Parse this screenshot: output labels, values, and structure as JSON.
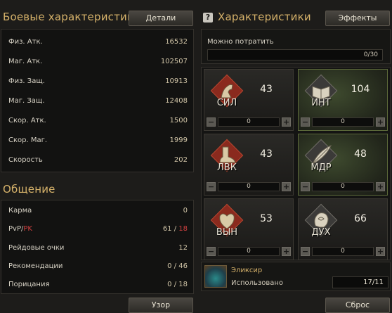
{
  "combat": {
    "title": "Боевые характеристики",
    "details_label": "Детали",
    "rows": [
      {
        "label": "Физ. Атк.",
        "value": "16532"
      },
      {
        "label": "Маг. Атк.",
        "value": "102507"
      },
      {
        "label": "Физ. Защ.",
        "value": "10913"
      },
      {
        "label": "Маг. Защ.",
        "value": "12408"
      },
      {
        "label": "Скор. Атк.",
        "value": "1500"
      },
      {
        "label": "Скор. Маг.",
        "value": "1999"
      },
      {
        "label": "Скорость",
        "value": "202"
      }
    ]
  },
  "social": {
    "title": "Общение",
    "karma_label": "Карма",
    "karma_value": "0",
    "pvp_label": "PvP/",
    "pk_label": "PK",
    "pvp_value": "61 / ",
    "pk_value": "18",
    "raid_label": "Рейдовые очки",
    "raid_value": "12",
    "rec_label": "Рекомендации",
    "rec_value": "0 / 46",
    "cens_label": "Порицания",
    "cens_value": "0 / 18",
    "pattern_label": "Узор"
  },
  "stats": {
    "help_icon": "?",
    "title": "Характеристики",
    "effects_label": "Эффекты",
    "can_spend_label": "Можно потратить",
    "can_spend_value": "0/30",
    "items": [
      {
        "abbr": "СИЛ",
        "value": "43",
        "step": "0",
        "icon": "arm-icon",
        "highlighted": false
      },
      {
        "abbr": "ИНТ",
        "value": "104",
        "step": "0",
        "icon": "book-icon",
        "highlighted": true
      },
      {
        "abbr": "ЛВК",
        "value": "43",
        "step": "0",
        "icon": "foot-icon",
        "highlighted": false
      },
      {
        "abbr": "МДР",
        "value": "48",
        "step": "0",
        "icon": "feather-icon",
        "highlighted": true
      },
      {
        "abbr": "ВЫН",
        "value": "53",
        "step": "0",
        "icon": "heart-icon",
        "highlighted": false
      },
      {
        "abbr": "ДУХ",
        "value": "66",
        "step": "0",
        "icon": "brain-icon",
        "highlighted": false
      }
    ],
    "minus": "−",
    "plus": "+",
    "elixir_title": "Эликсир",
    "elixir_used_label": "Использовано",
    "elixir_value": "17/11",
    "reset_label": "Сброс"
  },
  "colors": {
    "accent_gold": "#d6b26a",
    "pk_red": "#d04040",
    "highlight_green": "#3e4a2e"
  }
}
